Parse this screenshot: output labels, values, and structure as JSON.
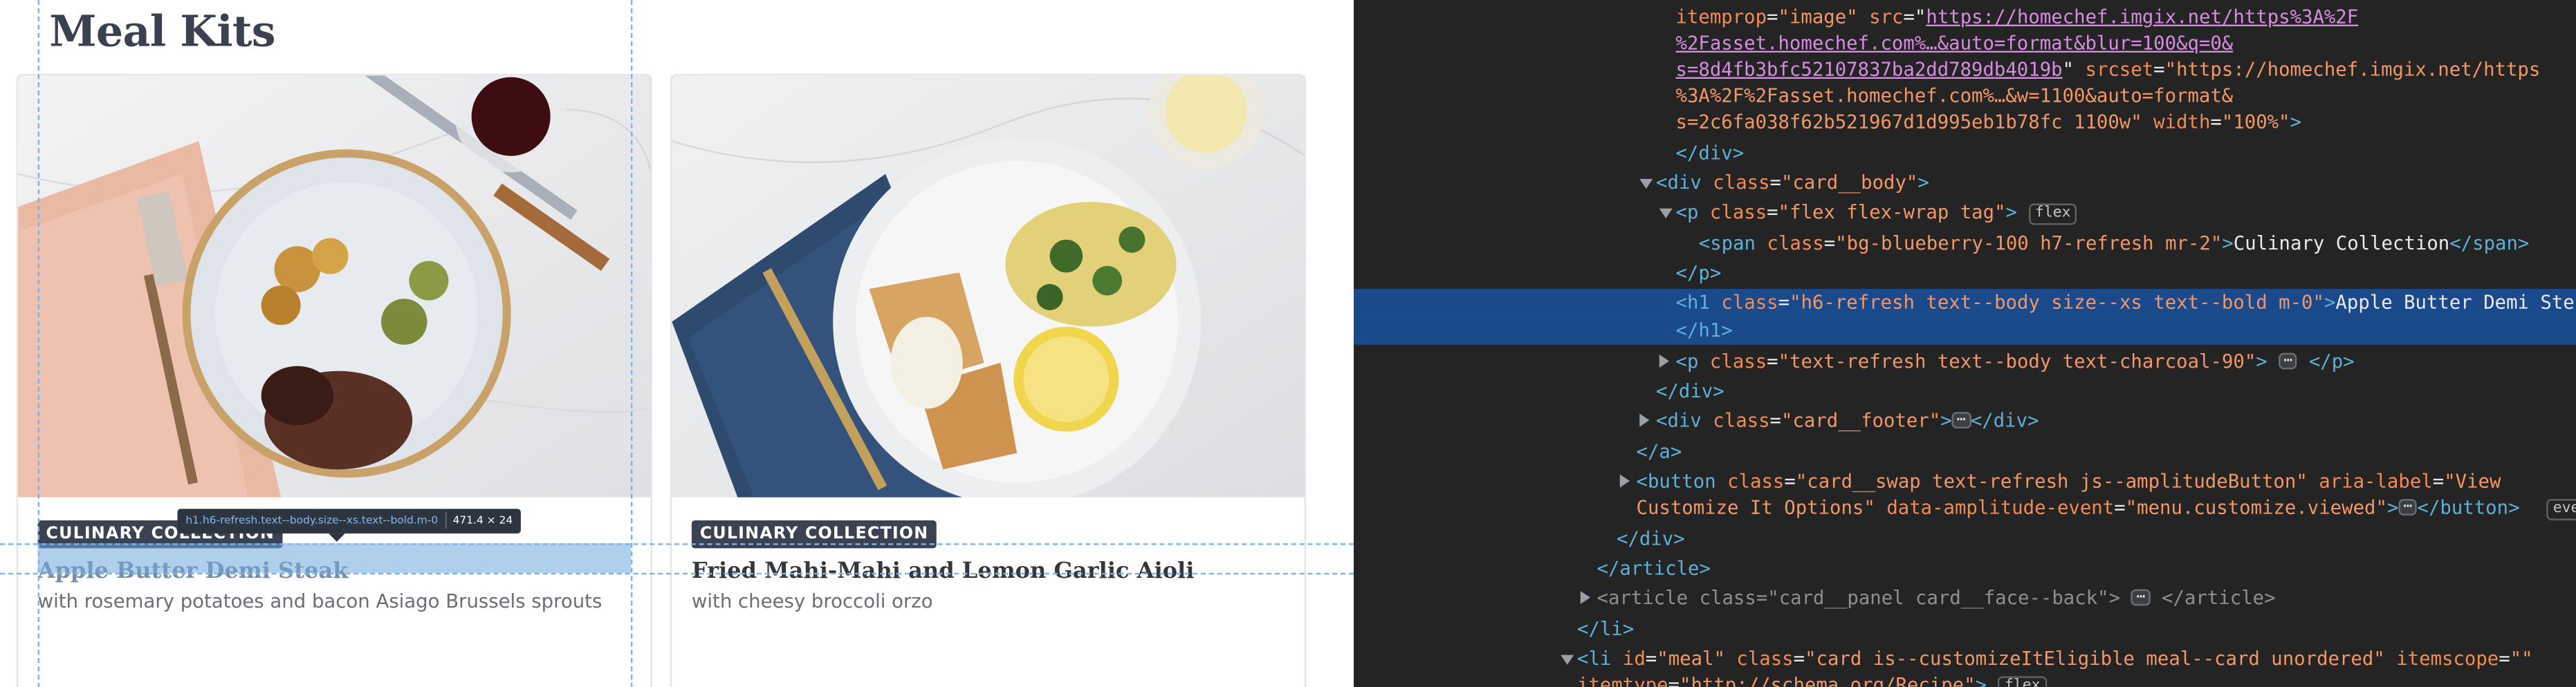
{
  "page": {
    "title": "Meal Kits"
  },
  "cards": [
    {
      "tag": "CULINARY COLLECTION",
      "title": "Apple Butter Demi Steak",
      "subtitle": "with rosemary potatoes and bacon Asiago Brussels sprouts"
    },
    {
      "tag": "CULINARY COLLECTION",
      "title": "Fried Mahi-Mahi and Lemon Garlic Aioli",
      "subtitle": "with cheesy broccoli orzo"
    }
  ],
  "inspector_tooltip": {
    "selector": "h1.h6-refresh.text--body.size--xs.text--bold.m-0",
    "size": "471.4 × 24"
  },
  "devtools": {
    "badges": {
      "flex": "flex",
      "ellipsis": "⋯",
      "event_truncated": "eve"
    },
    "lines": {
      "l0_attr": "itemprop",
      "l0_val": "\"image\"",
      "l0_attr2": "src",
      "l0_url1": "https://homechef.imgix.net/https%3A%2F",
      "l1_url": "%2Fasset.homechef.com%…&auto=format&blur=100&q=0&",
      "l2_url": "s=8d4fb3bfc52107837ba2dd789db4019b",
      "l2_attr": "srcset",
      "l2_val": "\"https://homechef.imgix.net/https",
      "l3_val": "%3A%2F%2Fasset.homechef.com%…&w=1100&auto=format&",
      "l4_val": "s=2c6fa038f62b521967d1d995eb1b78fc 1100w\"",
      "l4_attr": "width",
      "l4_val2": "\"100%\"",
      "l5": "</div>",
      "l6_tag": "div",
      "l6_class": "\"card__body\"",
      "l7_tag": "p",
      "l7_class": "\"flex flex-wrap tag\"",
      "l8_tag": "span",
      "l8_class": "\"bg-blueberry-100 h7-refresh mr-2\"",
      "l8_text": "Culinary Collection",
      "l9": "</p>",
      "l10_tag": "h1",
      "l10_class": "\"h6-refresh text--body size--xs text--bold m-0\"",
      "l10_text": "Apple Butter Demi Ste",
      "l11": "</h1>",
      "l12_tag": "p",
      "l12_class": "\"text-refresh text--body text-charcoal-90\"",
      "l13": "</div>",
      "l14_tag": "div",
      "l14_class": "\"card__footer\"",
      "l15": "</a>",
      "l16_tag": "button",
      "l16_class": "\"card__swap text-refresh js--amplitudeButton\"",
      "l16_attr2": "aria-label",
      "l16_val2": "\"View",
      "l17_val": "Customize It Options\"",
      "l17_attr": "data-amplitude-event",
      "l17_val2": "\"menu.customize.viewed\"",
      "l18": "</div>",
      "l19": "</article>",
      "l20_tag": "article",
      "l20_class": "\"card__panel card__face--back\"",
      "l21": "</li>",
      "l22_tag": "li",
      "l22_id": "\"meal\"",
      "l22_class": "\"card is--customizeItEligible meal--card unordered\"",
      "l22_attr3": "itemscope",
      "l22_val3": "\"\"",
      "l23_attr": "itemtype",
      "l23_val": "\"http://schema.org/Recipe\""
    }
  },
  "colors": {
    "tag_bg": "#3b4352",
    "devtools_bg": "#242424",
    "selected_row": "#1b4a8c",
    "highlight": "#6fa8dc"
  }
}
